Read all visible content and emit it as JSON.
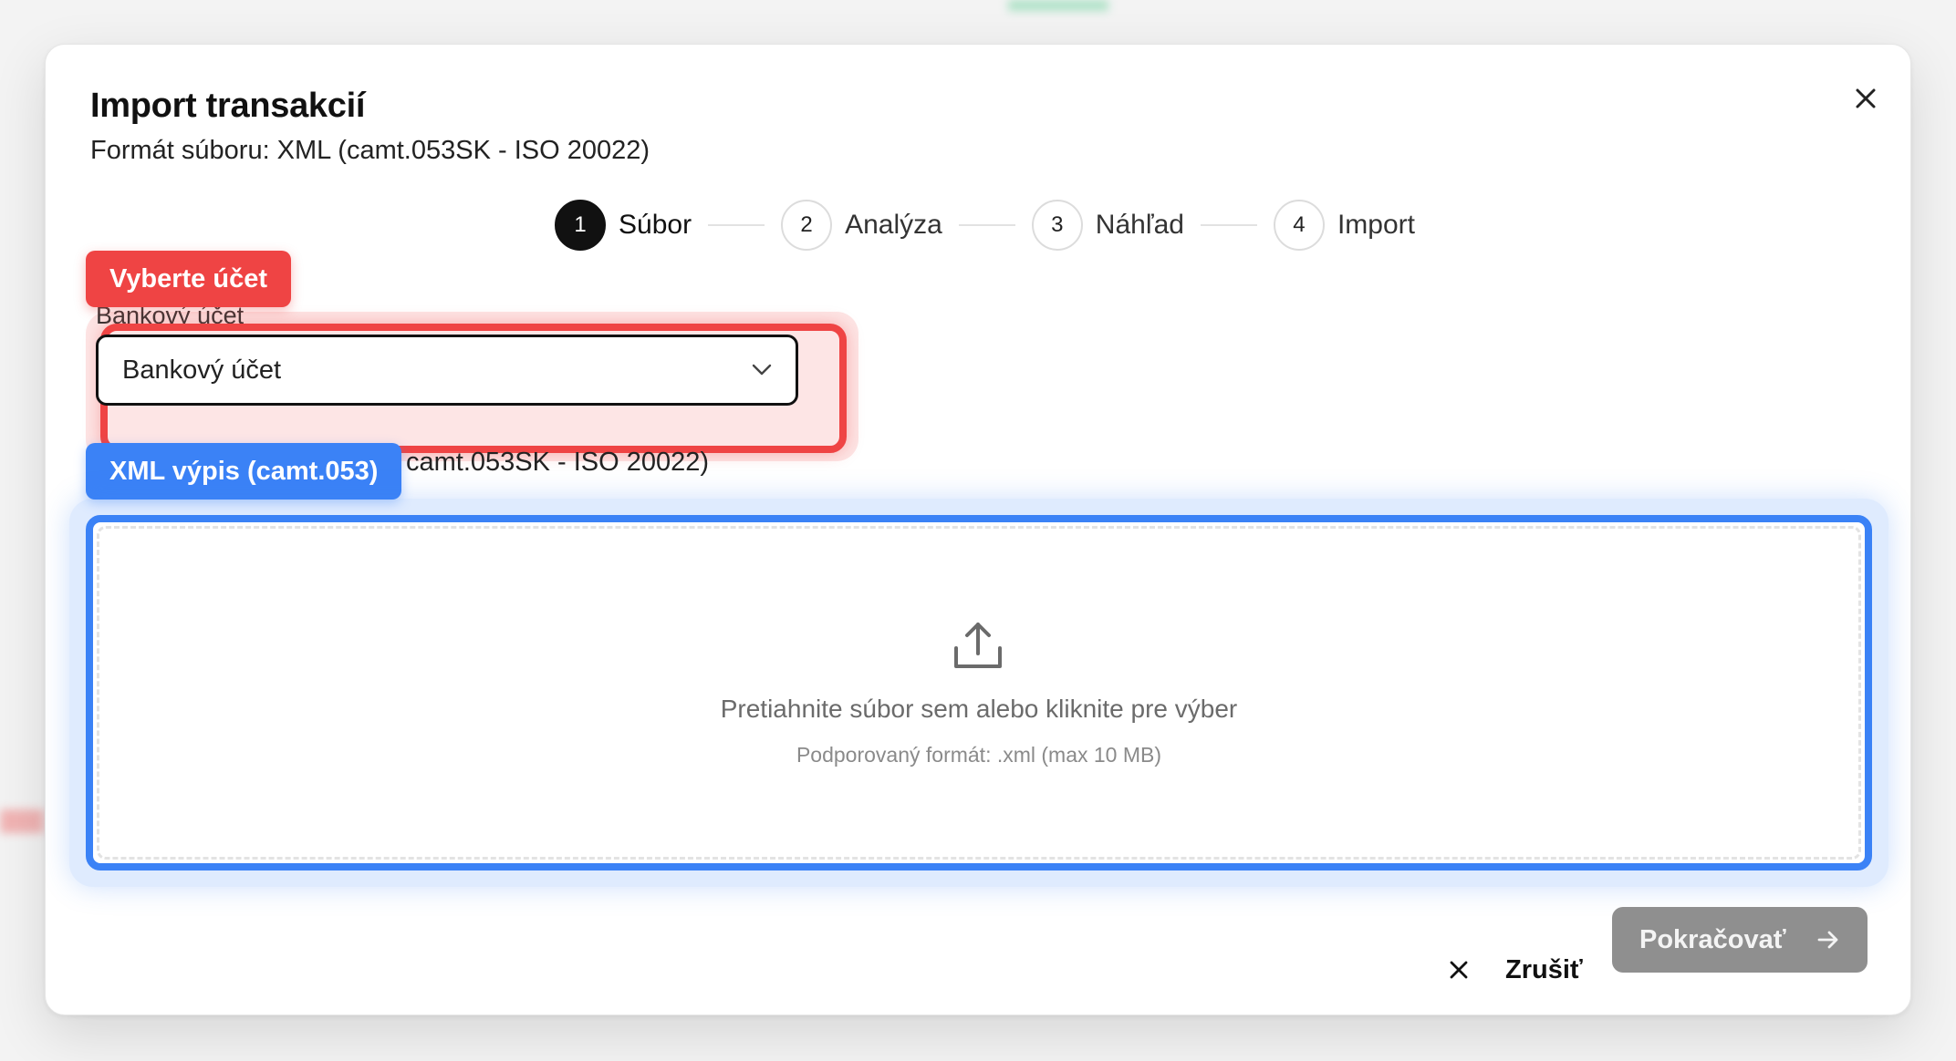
{
  "modal": {
    "title": "Import transakcií",
    "subtitle": "Formát súboru: XML (camt.053SK - ISO 20022)",
    "close_icon": "close-icon"
  },
  "stepper": {
    "steps": [
      {
        "number": "1",
        "label": "Súbor",
        "active": true
      },
      {
        "number": "2",
        "label": "Analýza",
        "active": false
      },
      {
        "number": "3",
        "label": "Náhľad",
        "active": false
      },
      {
        "number": "4",
        "label": "Import",
        "active": false
      }
    ]
  },
  "account": {
    "label": "Bankový účet",
    "select_value": "Bankový účet",
    "tag": "Vyberte účet",
    "tag_color": "#ef4444"
  },
  "file_format": {
    "text": "camt.053SK - ISO 20022)",
    "tag": "XML výpis (camt.053)",
    "tag_color": "#3b82f6"
  },
  "dropzone": {
    "icon": "upload-icon",
    "text": "Pretiahnite súbor sem alebo kliknite pre výber",
    "hint": "Podporovaný formát: .xml (max 10 MB)"
  },
  "footer": {
    "cancel_label": "Zrušiť",
    "continue_label": "Pokračovať"
  }
}
